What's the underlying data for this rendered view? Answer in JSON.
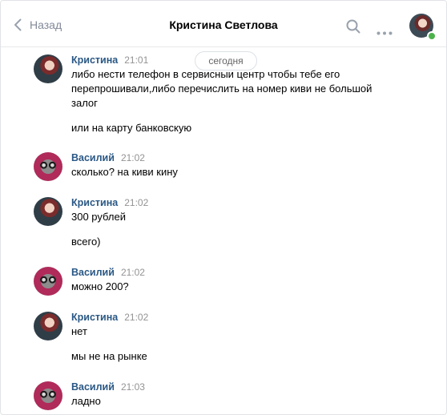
{
  "header": {
    "back_label": "Назад",
    "title": "Кристина Светлова"
  },
  "date_divider": "сегодня",
  "messages": [
    {
      "author": "Кристина",
      "time": "21:01",
      "lines": [
        "либо нести телефон в сервисныи центр чтобы тебе его",
        "перепрошивали,либо перечислить на номер киви не большой",
        "залог",
        "или на карту банковскую"
      ]
    },
    {
      "author": "Василий",
      "time": "21:02",
      "lines": [
        "сколько? на киви кину"
      ]
    },
    {
      "author": "Кристина",
      "time": "21:02",
      "lines": [
        "300 рублей",
        "всего)"
      ]
    },
    {
      "author": "Василий",
      "time": "21:02",
      "lines": [
        "можно 200?"
      ]
    },
    {
      "author": "Кристина",
      "time": "21:02",
      "lines": [
        "нет",
        "мы не на рынке"
      ]
    },
    {
      "author": "Василий",
      "time": "21:03",
      "lines": [
        "ладно"
      ]
    }
  ],
  "colors": {
    "author": "#2a5885",
    "time": "#939393",
    "online": "#4bb34b"
  }
}
